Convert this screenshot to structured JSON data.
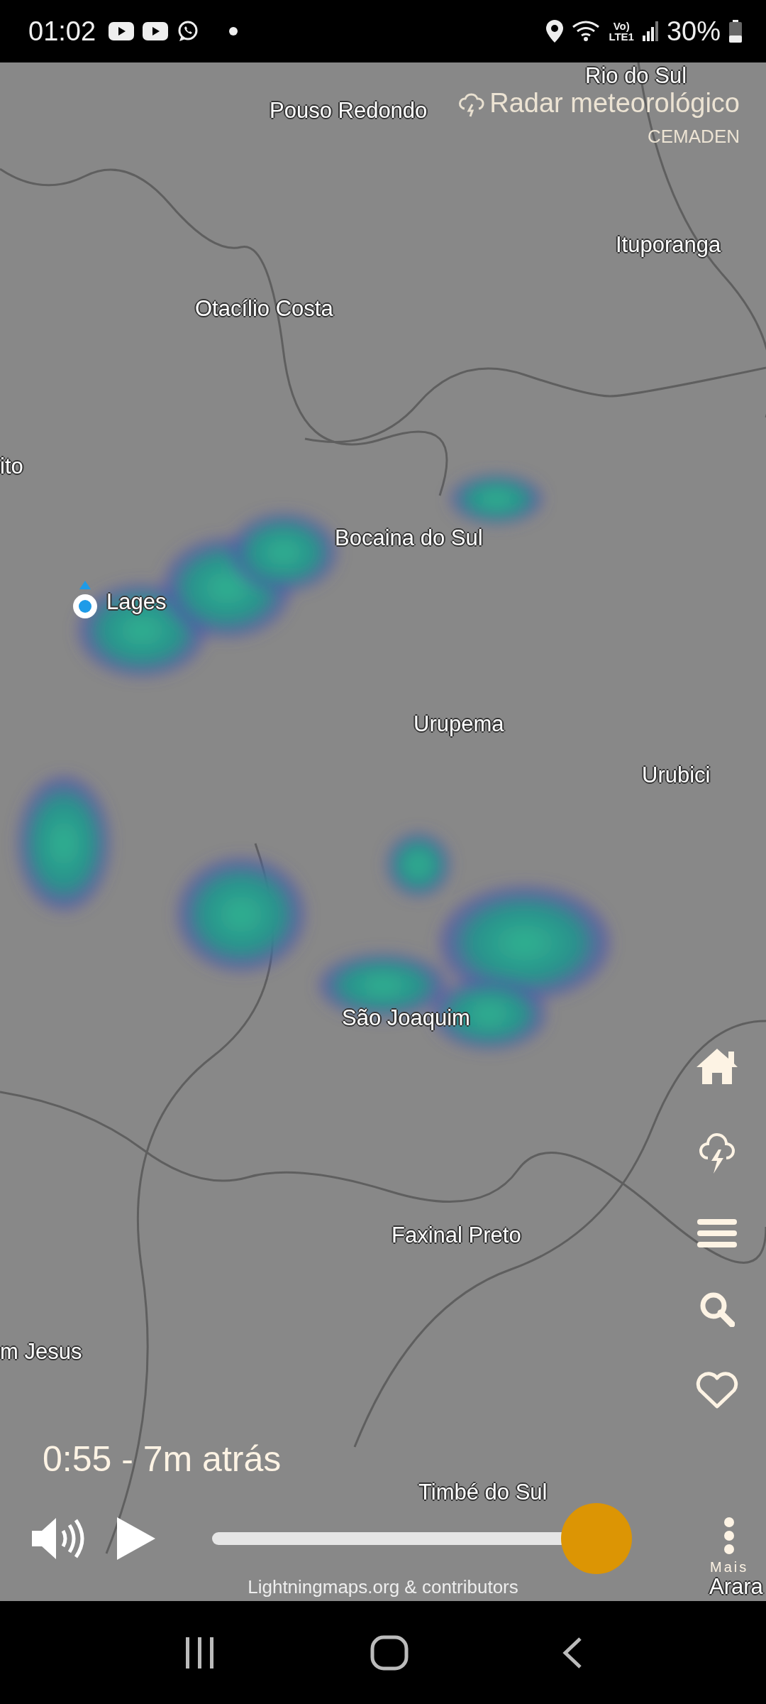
{
  "status_bar": {
    "time": "01:02",
    "volte": "Vo)",
    "network": "LTE1",
    "battery": "30%"
  },
  "radar_layer": {
    "title": "Radar meteorológico",
    "source": "CEMADEN"
  },
  "places": [
    "Rio do Sul",
    "Pouso Redondo",
    "Ituporanga",
    "Otacílio Costa",
    "ito",
    "Bocaina do Sul",
    "Lages",
    "Urupema",
    "Urubici",
    "São Joaquim",
    "Faxinal Preto",
    "m Jesus",
    "Timbé do Sul",
    "Arara"
  ],
  "timeline": {
    "label": "0:55 - 7m atrás",
    "level": 0.95,
    "more_label": "Mais"
  },
  "attribution": "Lightningmaps.org & contributors"
}
